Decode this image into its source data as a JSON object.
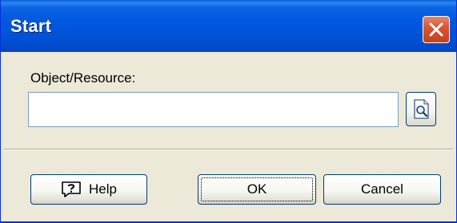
{
  "window": {
    "title": "Start"
  },
  "form": {
    "label": "Object/Resource:",
    "input_value": "",
    "input_placeholder": ""
  },
  "buttons": {
    "help": "Help",
    "ok": "OK",
    "cancel": "Cancel"
  },
  "icons": {
    "close": "close-icon",
    "browse": "browse-magnifier-icon",
    "help": "help-question-icon"
  },
  "colors": {
    "titlebar": "#0058DF",
    "close": "#D9532E",
    "dialog_bg": "#ECE9D8"
  }
}
